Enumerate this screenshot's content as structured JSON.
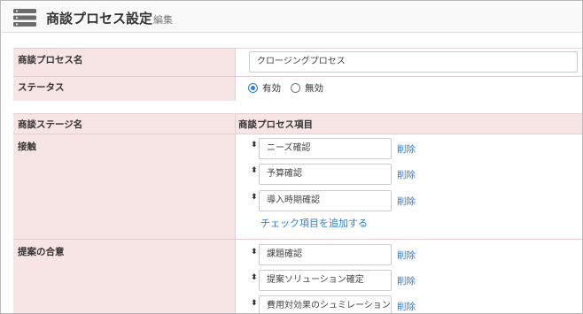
{
  "header": {
    "title": "商談プロセス設定",
    "subtitle": "編集",
    "icon": "server-stack-icon"
  },
  "form": {
    "process_name": {
      "label": "商談プロセス名",
      "value": "クロージングプロセス"
    },
    "status": {
      "label": "ステータス",
      "options": [
        {
          "label": "有効",
          "selected": true
        },
        {
          "label": "無効",
          "selected": false
        }
      ]
    }
  },
  "stages_table": {
    "headers": [
      "商談ステージ名",
      "商談プロセス項目"
    ],
    "delete_label": "削除",
    "add_item_label": "チェック項目を追加する",
    "stages": [
      {
        "name": "接触",
        "items": [
          "ニーズ確認",
          "予算確認",
          "導入時期確認"
        ]
      },
      {
        "name": "提案の合意",
        "items": [
          "課題確認",
          "提案ソリューション確定",
          "費用対効果のシュミレーション"
        ]
      }
    ]
  },
  "colors": {
    "accent": "#2a7ed8",
    "label_bg": "#f7e5e5",
    "header_bg": "#f9f9f9"
  }
}
